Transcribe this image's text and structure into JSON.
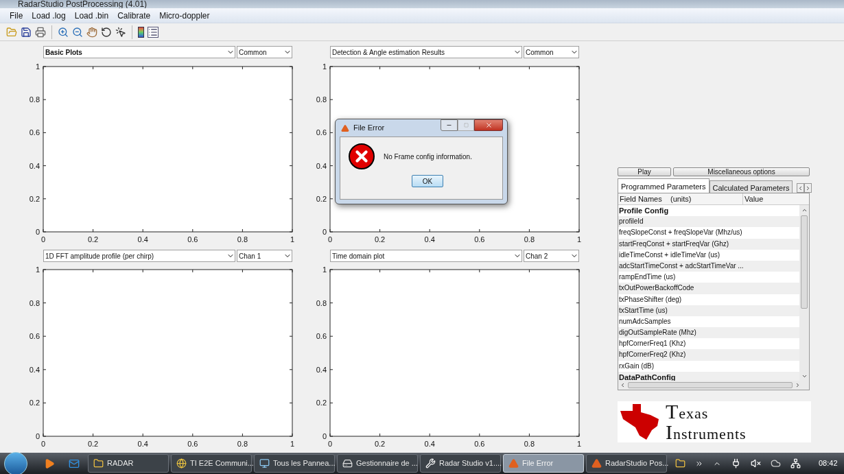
{
  "window": {
    "title": "RadarStudio PostProcessing (4.01)"
  },
  "menu": [
    "File",
    "Load .log",
    "Load .bin",
    "Calibrate",
    "Micro-doppler"
  ],
  "toolbar": [
    {
      "kind": "open"
    },
    {
      "kind": "save"
    },
    {
      "kind": "print"
    },
    {
      "kind": "sep"
    },
    {
      "kind": "zoom-in"
    },
    {
      "kind": "zoom-out"
    },
    {
      "kind": "pan"
    },
    {
      "kind": "rotate"
    },
    {
      "kind": "cursor"
    },
    {
      "kind": "sep"
    },
    {
      "kind": "colorbar"
    },
    {
      "kind": "legend"
    }
  ],
  "plots": [
    {
      "selector": "Basic Plots",
      "selector_focused": true,
      "option": "Common",
      "chart_data": {
        "type": "line",
        "xlim": [
          0,
          1
        ],
        "ylim": [
          0,
          1
        ],
        "xticks": [
          {
            "value": 0,
            "label": "0"
          },
          {
            "value": 0.2,
            "label": "0.2"
          },
          {
            "value": 0.4,
            "label": "0.4"
          },
          {
            "value": 0.6,
            "label": "0.6"
          },
          {
            "value": 0.8,
            "label": "0.8"
          },
          {
            "value": 1,
            "label": "1"
          }
        ],
        "yticks": [
          {
            "value": 0,
            "label": "0"
          },
          {
            "value": 0.2,
            "label": "0.2"
          },
          {
            "value": 0.4,
            "label": "0.4"
          },
          {
            "value": 0.6,
            "label": "0.6"
          },
          {
            "value": 0.8,
            "label": "0.8"
          },
          {
            "value": 1,
            "label": "1"
          }
        ]
      }
    },
    {
      "selector": "Detection & Angle estimation Results",
      "selector_focused": false,
      "option": "Common",
      "chart_data": {
        "type": "line",
        "xlim": [
          0,
          1
        ],
        "ylim": [
          0,
          1
        ],
        "xticks": [
          {
            "value": 0,
            "label": "0"
          },
          {
            "value": 0.2,
            "label": "0.2"
          },
          {
            "value": 0.4,
            "label": "0.4"
          },
          {
            "value": 0.6,
            "label": "0.6"
          },
          {
            "value": 0.8,
            "label": "0.8"
          },
          {
            "value": 1,
            "label": "1"
          }
        ],
        "yticks": [
          {
            "value": 0,
            "label": "0"
          },
          {
            "value": 0.2,
            "label": "0.2"
          },
          {
            "value": 0.4,
            "label": "0.4"
          },
          {
            "value": 0.6,
            "label": "0.6"
          },
          {
            "value": 0.8,
            "label": "0.8"
          },
          {
            "value": 1,
            "label": "1"
          }
        ]
      }
    },
    {
      "selector": "1D FFT amplitude profile (per chirp)",
      "selector_focused": false,
      "option": "Chan 1",
      "chart_data": {
        "type": "line",
        "xlim": [
          0,
          1
        ],
        "ylim": [
          0,
          1
        ],
        "xticks": [
          {
            "value": 0,
            "label": "0"
          },
          {
            "value": 0.2,
            "label": "0.2"
          },
          {
            "value": 0.4,
            "label": "0.4"
          },
          {
            "value": 0.6,
            "label": "0.6"
          },
          {
            "value": 0.8,
            "label": "0.8"
          },
          {
            "value": 1,
            "label": "1"
          }
        ],
        "yticks": [
          {
            "value": 0,
            "label": "0"
          },
          {
            "value": 0.2,
            "label": "0.2"
          },
          {
            "value": 0.4,
            "label": "0.4"
          },
          {
            "value": 0.6,
            "label": "0.6"
          },
          {
            "value": 0.8,
            "label": "0.8"
          },
          {
            "value": 1,
            "label": "1"
          }
        ]
      }
    },
    {
      "selector": "Time domain plot",
      "selector_focused": false,
      "option": "Chan 2",
      "chart_data": {
        "type": "line",
        "xlim": [
          0,
          1
        ],
        "ylim": [
          0,
          1
        ],
        "xticks": [
          {
            "value": 0,
            "label": "0"
          },
          {
            "value": 0.2,
            "label": "0.2"
          },
          {
            "value": 0.4,
            "label": "0.4"
          },
          {
            "value": 0.6,
            "label": "0.6"
          },
          {
            "value": 0.8,
            "label": "0.8"
          },
          {
            "value": 1,
            "label": "1"
          }
        ],
        "yticks": [
          {
            "value": 0,
            "label": "0"
          },
          {
            "value": 0.2,
            "label": "0.2"
          },
          {
            "value": 0.4,
            "label": "0.4"
          },
          {
            "value": 0.6,
            "label": "0.6"
          },
          {
            "value": 0.8,
            "label": "0.8"
          },
          {
            "value": 1,
            "label": "1"
          }
        ]
      }
    }
  ],
  "side_panel": {
    "buttons": [
      "Play",
      "Miscellaneous options"
    ],
    "tabs": [
      {
        "label": "Programmed Parameters",
        "selected": true
      },
      {
        "label": "Calculated Parameters",
        "selected": false
      }
    ],
    "table": {
      "columns": [
        "Field Names    (units)",
        "Value"
      ],
      "rows": [
        {
          "name": "Profile Config",
          "kind": "section"
        },
        {
          "name": "profileId",
          "kind": "field"
        },
        {
          "name": "freqSlopeConst + freqSlopeVar (Mhz/us)",
          "kind": "field"
        },
        {
          "name": "startFreqConst + startFreqVar (Ghz)",
          "kind": "field"
        },
        {
          "name": "idleTimeConst + idleTimeVar (us)",
          "kind": "field"
        },
        {
          "name": "adcStartTimeConst + adcStartTimeVar ...",
          "kind": "field"
        },
        {
          "name": "rampEndTime (us)",
          "kind": "field"
        },
        {
          "name": "txOutPowerBackoffCode",
          "kind": "field"
        },
        {
          "name": "txPhaseShifter (deg)",
          "kind": "field"
        },
        {
          "name": "txStartTime (us)",
          "kind": "field"
        },
        {
          "name": "numAdcSamples",
          "kind": "field"
        },
        {
          "name": "digOutSampleRate (Mhz)",
          "kind": "field"
        },
        {
          "name": "hpfCornerFreq1 (Khz)",
          "kind": "field"
        },
        {
          "name": "hpfCornerFreq2 (Khz)",
          "kind": "field"
        },
        {
          "name": "rxGain (dB)",
          "kind": "field"
        },
        {
          "name": "DataPathConfig",
          "kind": "section"
        }
      ]
    }
  },
  "logo": {
    "line1": "Texas",
    "line2": "Instruments"
  },
  "dialog": {
    "title": "File Error",
    "message": "No Frame config information.",
    "button": "OK"
  },
  "taskbar": {
    "quick_launch": [
      {
        "kind": "media"
      },
      {
        "kind": "mail"
      }
    ],
    "items": [
      {
        "label": "RADAR",
        "kind": "folder",
        "selected": false
      },
      {
        "label": "TI E2E Communi...",
        "kind": "browser",
        "selected": false
      },
      {
        "label": "Tous les Pannea...",
        "kind": "panel",
        "selected": false
      },
      {
        "label": "Gestionnaire de ...",
        "kind": "device",
        "selected": false
      },
      {
        "label": "Radar Studio v1....",
        "kind": "tools",
        "selected": false
      },
      {
        "label": "File Error",
        "kind": "matlab",
        "selected": true
      },
      {
        "label": "RadarStudio Pos...",
        "kind": "matlab",
        "selected": false
      }
    ],
    "clock": "08:42"
  }
}
